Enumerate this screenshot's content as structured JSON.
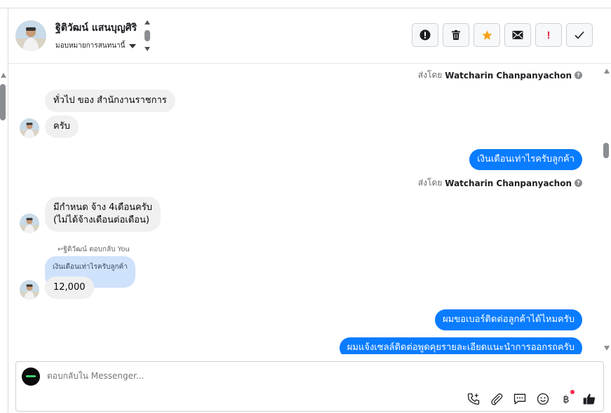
{
  "header": {
    "contact_name": "ฐิติวัฒน์ แสนบุญศิริ",
    "assign_label": "มอบหมายการสนทนานี้",
    "actions": [
      {
        "name": "report-button",
        "icon": "alert-circle-icon"
      },
      {
        "name": "delete-button",
        "icon": "trash-icon"
      },
      {
        "name": "star-button",
        "icon": "star-icon"
      },
      {
        "name": "mark-unread-button",
        "icon": "envelope-icon"
      },
      {
        "name": "important-button",
        "icon": "exclamation-icon",
        "glyph": "!"
      },
      {
        "name": "done-button",
        "icon": "check-icon"
      }
    ]
  },
  "chat": {
    "sent_by_prefix": "ส่งโดย",
    "agent_name": "Watcharin Chanpanyachon",
    "messages": {
      "in1": "ทั่วไป ของ สำนักงานราชการ",
      "in2": "ครับ",
      "out1": "เงินเดือนเท่าไรครับลูกค้า",
      "in3_line1": "มีกำหนด จ้าง 4เดือนครับ",
      "in3_line2": "(ไม่ได้จ้างเดือนต่อเดือน)",
      "reply_label": "ฐิติวัฒน์ ตอบกลับ You",
      "quoted": "เงินเดือนเท่าไรครับลูกค้า",
      "in4": "12,000",
      "out2": "ผมขอเบอร์ติดต่อลูกค้าได้ไหมครับ",
      "out3": "ผมแจ้งเซลล์ติดต่อพูดคุยรายละเอียดแนะนำการออกรถครับ"
    }
  },
  "composer": {
    "placeholder": "ตอบกลับใน Messenger...",
    "icons": [
      "phone-add-icon",
      "paperclip-icon",
      "saved-reply-icon",
      "emoji-icon",
      "baht-icon",
      "thumbs-up-icon"
    ]
  },
  "colors": {
    "accent": "#0a7cff",
    "incoming_bubble": "#f0f0f0",
    "quote_bubble": "#cfe2fb",
    "star": "#f7a21b",
    "important": "#e41e3f"
  }
}
